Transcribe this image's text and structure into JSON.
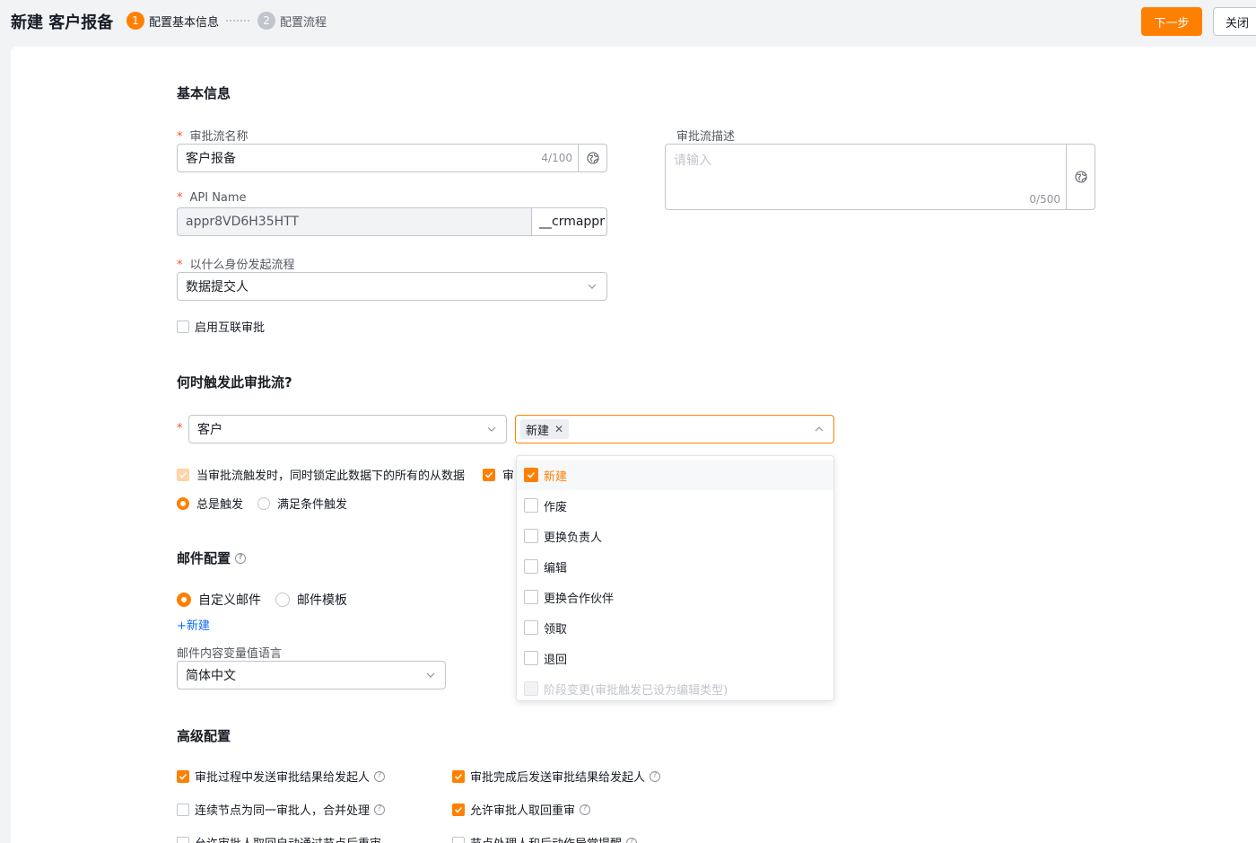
{
  "header": {
    "title": "新建 客户报备",
    "steps": [
      {
        "num": "1",
        "label": "配置基本信息"
      },
      {
        "num": "2",
        "label": "配置流程"
      }
    ],
    "next_button": "下一步",
    "close_button": "关闭"
  },
  "basic_info": {
    "section_title": "基本信息",
    "name_label": "审批流名称",
    "name_value": "客户报备",
    "name_count": "4/100",
    "desc_label": "审批流描述",
    "desc_placeholder": "请输入",
    "desc_count": "0/500",
    "api_label": "API Name",
    "api_value": "appr8VD6H35HTT",
    "api_suffix": "__crmappr",
    "identity_label": "以什么身份发起流程",
    "identity_value": "数据提交人",
    "interconnect_label": "启用互联审批"
  },
  "trigger": {
    "section_title": "何时触发此审批流?",
    "object_value": "客户",
    "selected_tag": "新建",
    "lock_label": "当审批流触发时，同时锁定此数据下的所有的从数据",
    "second_check_label": "审",
    "always_label": "总是触发",
    "condition_label": "满足条件触发"
  },
  "dropdown": {
    "options": [
      {
        "label": "新建",
        "state": "checked"
      },
      {
        "label": "作废",
        "state": "unchecked"
      },
      {
        "label": "更换负责人",
        "state": "unchecked"
      },
      {
        "label": "编辑",
        "state": "unchecked"
      },
      {
        "label": "更换合作伙伴",
        "state": "unchecked"
      },
      {
        "label": "领取",
        "state": "unchecked"
      },
      {
        "label": "退回",
        "state": "unchecked"
      },
      {
        "label": "阶段变更(审批触发已设为编辑类型)",
        "state": "disabled"
      }
    ]
  },
  "mail": {
    "section_title": "邮件配置",
    "custom_label": "自定义邮件",
    "template_label": "邮件模板",
    "new_link": "+新建",
    "lang_label": "邮件内容变量值语言",
    "lang_value": "简体中文"
  },
  "advanced": {
    "section_title": "高级配置",
    "items": [
      {
        "label": "审批过程中发送审批结果给发起人",
        "checked": true
      },
      {
        "label": "审批完成后发送审批结果给发起人",
        "checked": true
      },
      {
        "label": "连续节点为同一审批人，合并处理",
        "checked": false
      },
      {
        "label": "允许审批人取回重审",
        "checked": true
      },
      {
        "label": "允许审批人取回自动通过节点后重审",
        "checked": false
      },
      {
        "label": "节点处理人和后动作异常提醒",
        "checked": false
      }
    ]
  },
  "colors": {
    "accent": "#ff8000",
    "link": "#0c6cff",
    "required": "#ff522a"
  }
}
